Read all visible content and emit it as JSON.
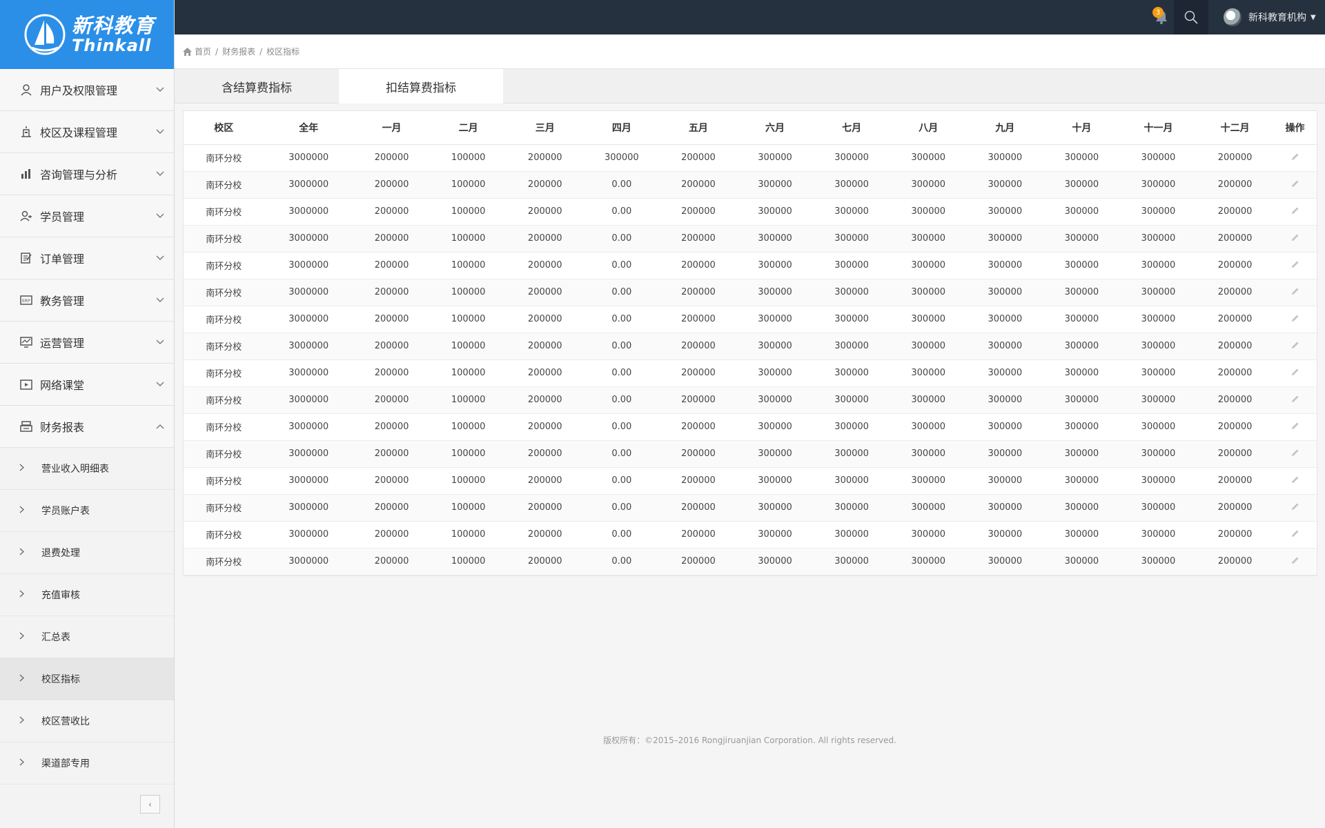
{
  "brand": {
    "name_cn": "新科教育",
    "name_en": "Thinkall"
  },
  "sidebar": {
    "items": [
      {
        "label": "用户及权限管理",
        "icon": "user-icon",
        "expanded": false
      },
      {
        "label": "校区及课程管理",
        "icon": "building-icon",
        "expanded": false
      },
      {
        "label": "咨询管理与分析",
        "icon": "bar-chart-icon",
        "expanded": false
      },
      {
        "label": "学员管理",
        "icon": "students-icon",
        "expanded": false
      },
      {
        "label": "订单管理",
        "icon": "order-icon",
        "expanded": false
      },
      {
        "label": "教务管理",
        "icon": "erp-icon",
        "expanded": false
      },
      {
        "label": "运营管理",
        "icon": "monitor-chart-icon",
        "expanded": false
      },
      {
        "label": "网络课堂",
        "icon": "video-icon",
        "expanded": false
      },
      {
        "label": "财务报表",
        "icon": "cashier-icon",
        "expanded": true
      }
    ],
    "subitems": [
      {
        "label": "营业收入明细表",
        "active": false
      },
      {
        "label": "学员账户表",
        "active": false
      },
      {
        "label": "退费处理",
        "active": false
      },
      {
        "label": "充值审核",
        "active": false
      },
      {
        "label": "汇总表",
        "active": false
      },
      {
        "label": "校区指标",
        "active": true
      },
      {
        "label": "校区营收比",
        "active": false
      },
      {
        "label": "渠道部专用",
        "active": false
      }
    ]
  },
  "topbar": {
    "notification_count": "3",
    "user_name": "新科教育机构"
  },
  "breadcrumb": [
    "首页",
    "财务报表",
    "校区指标"
  ],
  "tabs": [
    {
      "label": "含结算费指标",
      "active": false
    },
    {
      "label": "扣结算费指标",
      "active": true
    }
  ],
  "table": {
    "headers": [
      "校区",
      "全年",
      "一月",
      "二月",
      "三月",
      "四月",
      "五月",
      "六月",
      "七月",
      "八月",
      "九月",
      "十月",
      "十一月",
      "十二月",
      "操作"
    ],
    "rows": [
      [
        "南环分校",
        "3000000",
        "200000",
        "100000",
        "200000",
        "300000",
        "200000",
        "300000",
        "300000",
        "300000",
        "300000",
        "300000",
        "300000",
        "200000"
      ],
      [
        "南环分校",
        "3000000",
        "200000",
        "100000",
        "200000",
        "0.00",
        "200000",
        "300000",
        "300000",
        "300000",
        "300000",
        "300000",
        "300000",
        "200000"
      ],
      [
        "南环分校",
        "3000000",
        "200000",
        "100000",
        "200000",
        "0.00",
        "200000",
        "300000",
        "300000",
        "300000",
        "300000",
        "300000",
        "300000",
        "200000"
      ],
      [
        "南环分校",
        "3000000",
        "200000",
        "100000",
        "200000",
        "0.00",
        "200000",
        "300000",
        "300000",
        "300000",
        "300000",
        "300000",
        "300000",
        "200000"
      ],
      [
        "南环分校",
        "3000000",
        "200000",
        "100000",
        "200000",
        "0.00",
        "200000",
        "300000",
        "300000",
        "300000",
        "300000",
        "300000",
        "300000",
        "200000"
      ],
      [
        "南环分校",
        "3000000",
        "200000",
        "100000",
        "200000",
        "0.00",
        "200000",
        "300000",
        "300000",
        "300000",
        "300000",
        "300000",
        "300000",
        "200000"
      ],
      [
        "南环分校",
        "3000000",
        "200000",
        "100000",
        "200000",
        "0.00",
        "200000",
        "300000",
        "300000",
        "300000",
        "300000",
        "300000",
        "300000",
        "200000"
      ],
      [
        "南环分校",
        "3000000",
        "200000",
        "100000",
        "200000",
        "0.00",
        "200000",
        "300000",
        "300000",
        "300000",
        "300000",
        "300000",
        "300000",
        "200000"
      ],
      [
        "南环分校",
        "3000000",
        "200000",
        "100000",
        "200000",
        "0.00",
        "200000",
        "300000",
        "300000",
        "300000",
        "300000",
        "300000",
        "300000",
        "200000"
      ],
      [
        "南环分校",
        "3000000",
        "200000",
        "100000",
        "200000",
        "0.00",
        "200000",
        "300000",
        "300000",
        "300000",
        "300000",
        "300000",
        "300000",
        "200000"
      ],
      [
        "南环分校",
        "3000000",
        "200000",
        "100000",
        "200000",
        "0.00",
        "200000",
        "300000",
        "300000",
        "300000",
        "300000",
        "300000",
        "300000",
        "200000"
      ],
      [
        "南环分校",
        "3000000",
        "200000",
        "100000",
        "200000",
        "0.00",
        "200000",
        "300000",
        "300000",
        "300000",
        "300000",
        "300000",
        "300000",
        "200000"
      ],
      [
        "南环分校",
        "3000000",
        "200000",
        "100000",
        "200000",
        "0.00",
        "200000",
        "300000",
        "300000",
        "300000",
        "300000",
        "300000",
        "300000",
        "200000"
      ],
      [
        "南环分校",
        "3000000",
        "200000",
        "100000",
        "200000",
        "0.00",
        "200000",
        "300000",
        "300000",
        "300000",
        "300000",
        "300000",
        "300000",
        "200000"
      ],
      [
        "南环分校",
        "3000000",
        "200000",
        "100000",
        "200000",
        "0.00",
        "200000",
        "300000",
        "300000",
        "300000",
        "300000",
        "300000",
        "300000",
        "200000"
      ],
      [
        "南环分校",
        "3000000",
        "200000",
        "100000",
        "200000",
        "0.00",
        "200000",
        "300000",
        "300000",
        "300000",
        "300000",
        "300000",
        "300000",
        "200000"
      ]
    ],
    "action_icon": "pencil-icon"
  },
  "footer": {
    "copyright": "版权所有：©2015–2016 Rongjiruanjian Corporation. All rights reserved."
  },
  "colors": {
    "brand_blue": "#2b8fe8",
    "topbar": "#26313f",
    "badge": "#f39c12"
  }
}
